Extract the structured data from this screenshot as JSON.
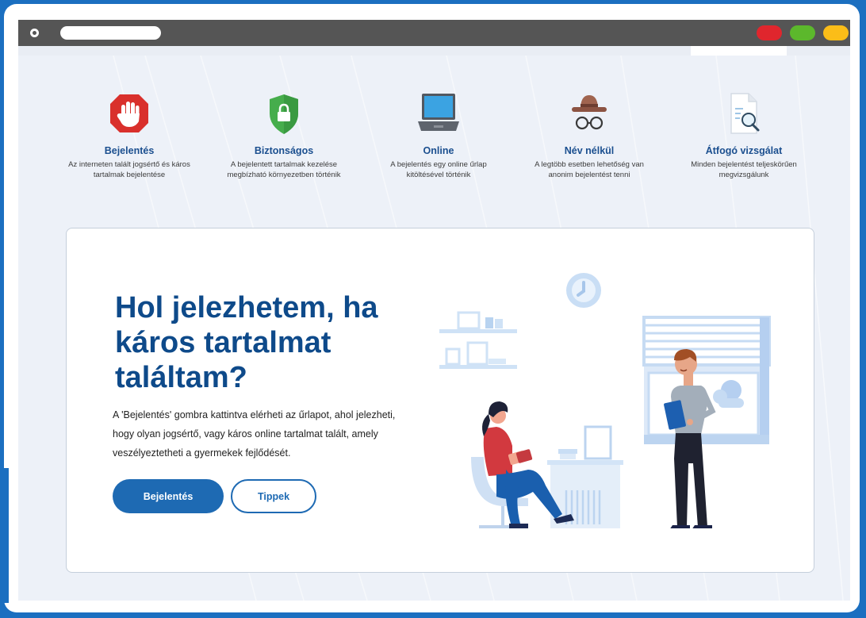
{
  "features": [
    {
      "icon": "stop-hand-icon",
      "title": "Bejelentés",
      "desc": "Az interneten talált jogsértő és káros tartalmak bejelentése"
    },
    {
      "icon": "shield-lock-icon",
      "title": "Biztonságos",
      "desc": "A bejelentett tartalmak kezelése megbízható környezetben történik"
    },
    {
      "icon": "laptop-icon",
      "title": "Online",
      "desc": "A bejelentés egy online űrlap kitöltésével történik"
    },
    {
      "icon": "incognito-icon",
      "title": "Név nélkül",
      "desc": "A legtöbb esetben lehetőség van anonim bejelentést tenni"
    },
    {
      "icon": "document-search-icon",
      "title": "Átfogó vizsgálat",
      "desc": "Minden bejelentést teljeskörűen megvizsgálunk"
    }
  ],
  "hero": {
    "heading": "Hol jelezhetem, ha káros tartalmat találtam?",
    "body": "A 'Bejelentés' gombra kattintva elérheti az űrlapot, ahol jelezheti, hogy olyan jogsértő, vagy káros online tartalmat talált, amely veszélyeztetheti a gyermekek fejlődését.",
    "primary_button": "Bejelentés",
    "secondary_button": "Tippek"
  },
  "colors": {
    "outer_frame": "#1b6fc0",
    "page_bg": "#edf1f8",
    "heading": "#0e4a8a",
    "feature_title": "#1b4f8f",
    "button_primary": "#1e6ab3",
    "window_red": "#e0262d",
    "window_green": "#5cb82c",
    "window_yellow": "#fbbd18"
  }
}
